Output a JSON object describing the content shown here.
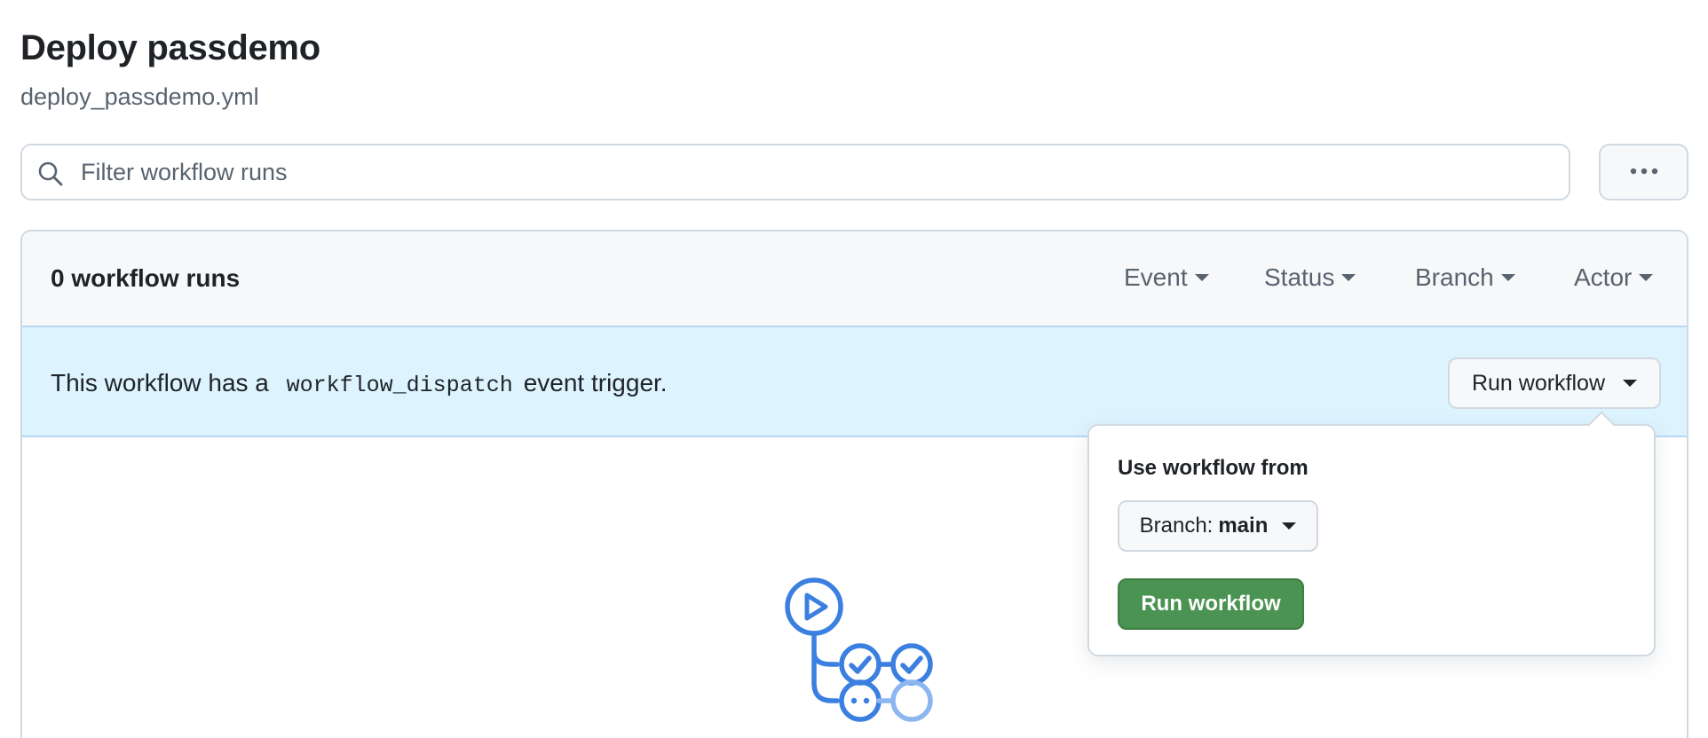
{
  "header": {
    "title": "Deploy passdemo",
    "subtitle": "deploy_passdemo.yml"
  },
  "search": {
    "placeholder": "Filter workflow runs",
    "value": ""
  },
  "more_button": {
    "icon": "kebab-horizontal-icon"
  },
  "runs": {
    "count_label": "0 workflow runs",
    "filters": [
      "Event",
      "Status",
      "Branch",
      "Actor"
    ]
  },
  "banner": {
    "text_before": "This workflow has a",
    "code": "workflow_dispatch",
    "text_after": "event trigger.",
    "run_button_label": "Run workflow"
  },
  "popover": {
    "label": "Use workflow from",
    "branch_prefix": "Branch:",
    "branch_name": "main",
    "submit_label": "Run workflow"
  },
  "empty_state": {
    "icon": "workflow-graph-icon"
  },
  "colors": {
    "banner_bg": "#ddf4ff",
    "primary_green": "#4a9352",
    "accent_blue": "#3b7fe0"
  }
}
